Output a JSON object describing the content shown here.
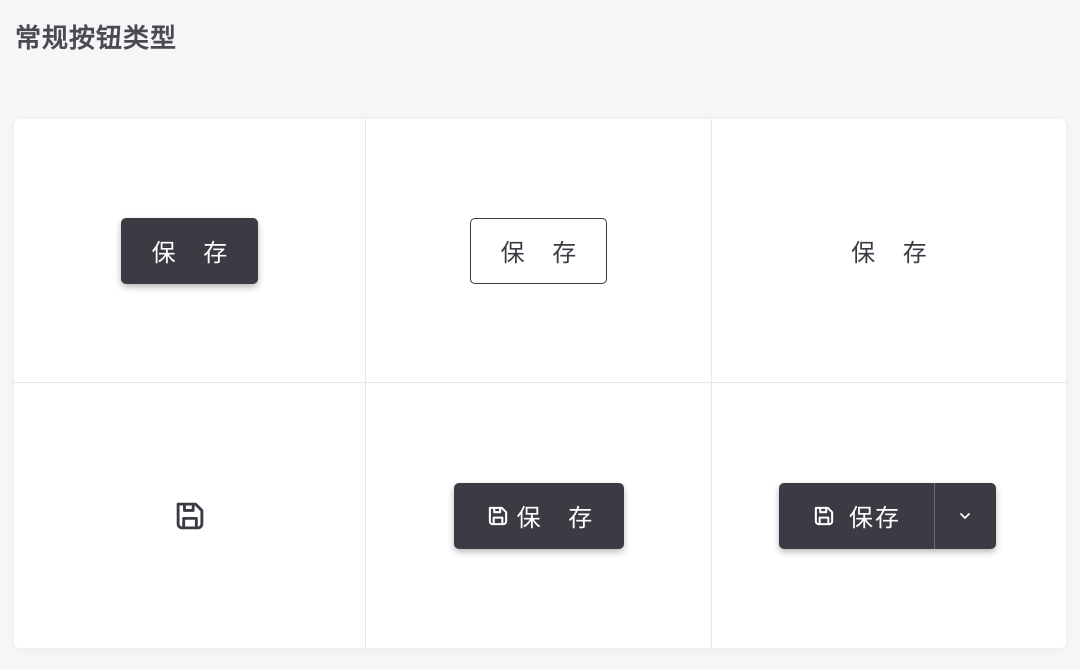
{
  "title": "常规按钮类型",
  "buttons": {
    "solid": {
      "label": "保 存"
    },
    "outline": {
      "label": "保 存"
    },
    "text": {
      "label": "保 存"
    },
    "icon_only": {
      "icon": "save-icon"
    },
    "icon_text": {
      "icon": "save-icon",
      "label": "保 存"
    },
    "split": {
      "icon": "save-icon",
      "label": "保存",
      "toggle_icon": "chevron-down-icon"
    }
  },
  "colors": {
    "primary": "#3b3c43",
    "background": "#f5f6f8",
    "panel": "#ffffff",
    "grid_line": "#e6e7ea",
    "title_text": "#4a4b50"
  }
}
